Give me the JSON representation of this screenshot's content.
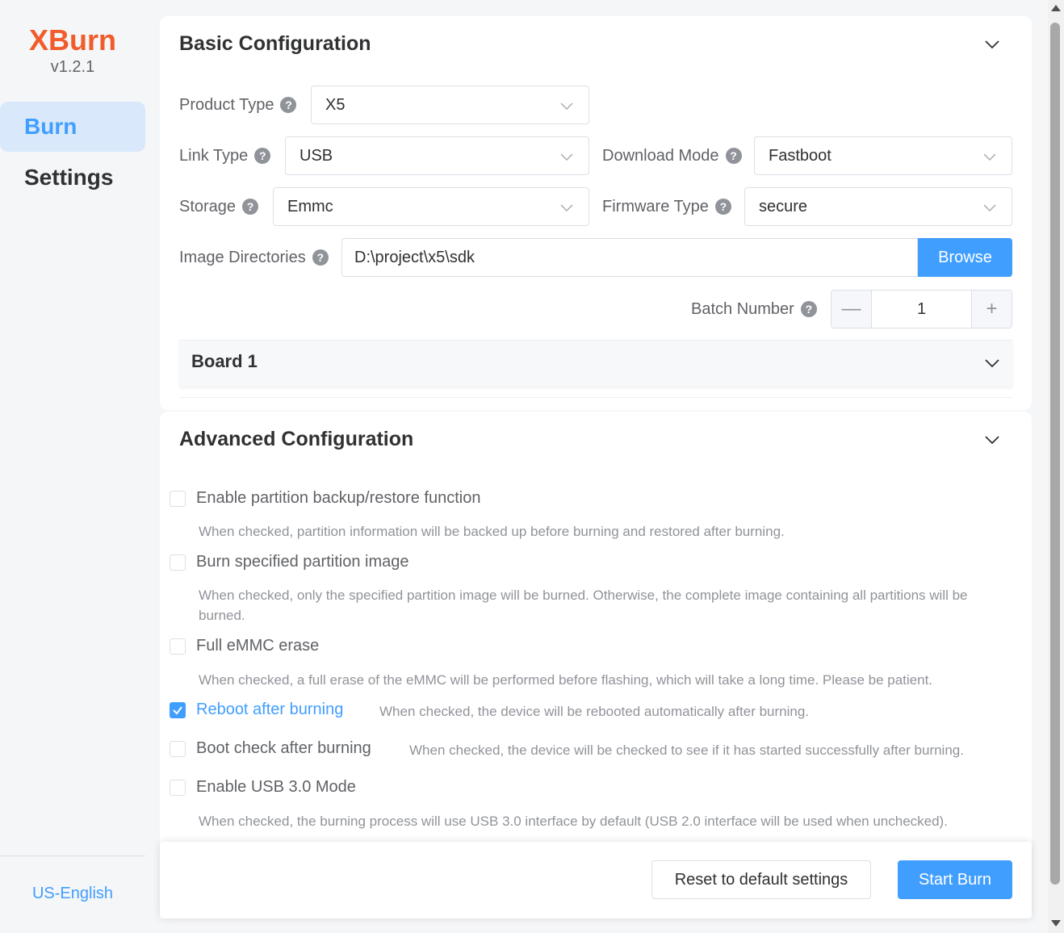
{
  "sidebar": {
    "brand": "XBurn",
    "version": "v1.2.1",
    "items": [
      {
        "label": "Burn",
        "active": true
      },
      {
        "label": "Settings",
        "active": false
      }
    ],
    "language": "US-English"
  },
  "basic": {
    "title": "Basic Configuration",
    "product_type": {
      "label": "Product Type",
      "value": "X5"
    },
    "link_type": {
      "label": "Link Type",
      "value": "USB"
    },
    "download_mode": {
      "label": "Download Mode",
      "value": "Fastboot"
    },
    "storage": {
      "label": "Storage",
      "value": "Emmc"
    },
    "firmware_type": {
      "label": "Firmware Type",
      "value": "secure"
    },
    "image_directories": {
      "label": "Image Directories",
      "value": "D:\\project\\x5\\sdk",
      "button": "Browse"
    },
    "batch_number": {
      "label": "Batch Number",
      "value": "1",
      "minus": "—",
      "plus": "+"
    },
    "board": {
      "title": "Board 1"
    }
  },
  "advanced": {
    "title": "Advanced Configuration",
    "options": [
      {
        "label": "Enable partition backup/restore function",
        "checked": false,
        "hint": "When checked, partition information will be backed up before burning and restored after burning."
      },
      {
        "label": "Burn specified partition image",
        "checked": false,
        "hint": "When checked, only the specified partition image will be burned. Otherwise, the complete image containing all partitions will be burned."
      },
      {
        "label": "Full eMMC erase",
        "checked": false,
        "hint": "When checked, a full erase of the eMMC will be performed before flashing, which will take a long time. Please be patient."
      },
      {
        "label": "Reboot after burning",
        "checked": true,
        "hint": "When checked, the device will be rebooted automatically after burning."
      },
      {
        "label": "Boot check after burning",
        "checked": false,
        "hint": "When checked, the device will be checked to see if it has started successfully after burning."
      },
      {
        "label": "Enable USB 3.0 Mode",
        "checked": false,
        "hint": "When checked, the burning process will use USB 3.0 interface by default (USB 2.0 interface will be used when unchecked)."
      }
    ]
  },
  "footer": {
    "reset_label": "Reset to default settings",
    "start_label": "Start Burn"
  },
  "colors": {
    "brand": "#f25c2a",
    "accent": "#409eff",
    "active_nav_bg": "#d9e8fb"
  }
}
